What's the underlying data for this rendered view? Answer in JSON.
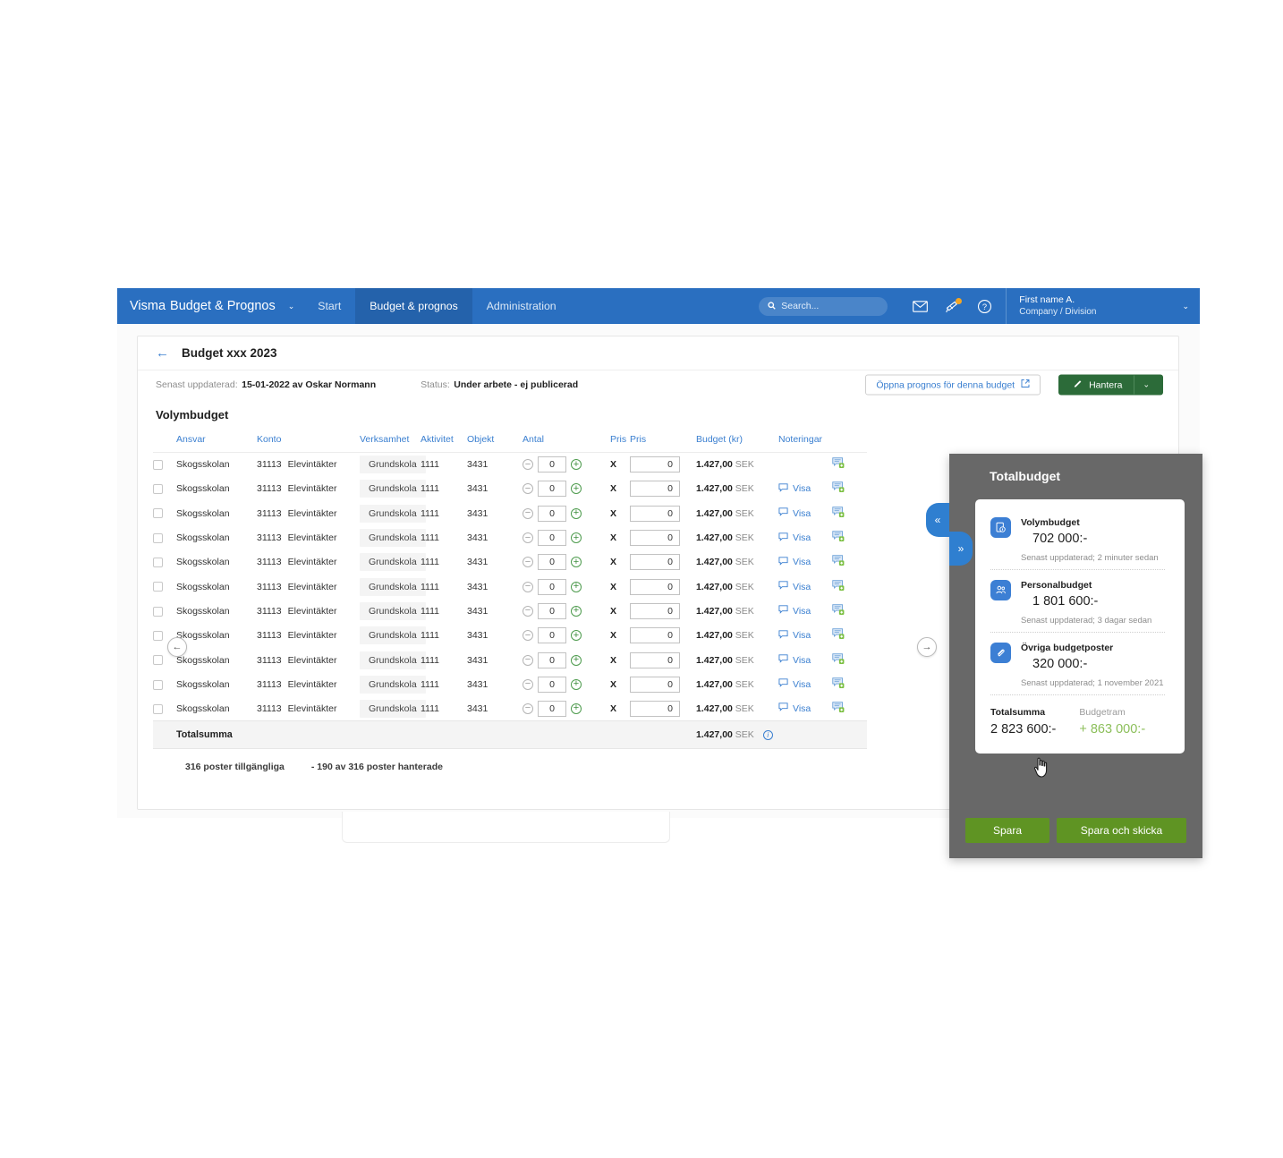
{
  "topbar": {
    "brand_primary": "Visma",
    "brand_secondary": "Budget & Prognos",
    "brand_caret": "⌄",
    "nav": [
      {
        "label": "Start",
        "active": false
      },
      {
        "label": "Budget & prognos",
        "active": true
      },
      {
        "label": "Administration",
        "active": false
      }
    ],
    "search_placeholder": "Search...",
    "icons": [
      "mail-icon",
      "megaphone-icon",
      "help-icon"
    ],
    "user_name": "First name A.",
    "user_org": "Company / Division",
    "user_caret": "⌄",
    "accent_color": "#2a6fc0",
    "active_tab_color": "#2462ab"
  },
  "card": {
    "back_arrow": "←",
    "title": "Budget xxx 2023",
    "meta": {
      "updated_label": "Senast uppdaterad:",
      "updated_value": "15-01-2022 av Oskar Normann",
      "status_label": "Status:",
      "status_value": "Under arbete - ej publicerad"
    },
    "actions": {
      "open_forecast": "Öppna  prognos för denna budget",
      "manage": "Hantera",
      "manage_caret": "⌄",
      "manage_color": "#2c6b39"
    },
    "section_title": "Volymbudget"
  },
  "table": {
    "headers": [
      "Ansvar",
      "Konto",
      "Verksamhet",
      "Aktivitet",
      "Objekt",
      "Antal",
      "Pris",
      "Pris",
      "Budget (kr)",
      "Noteringar"
    ],
    "rows": [
      {
        "ansvar": "Skogsskolan",
        "konto_num": "31113",
        "konto_name": "Elevintäkter",
        "verksamhet": "Grundskola",
        "aktivitet": "1111",
        "objekt": "3431",
        "antal": "0",
        "pris": "0",
        "x": "X",
        "budget_amount": "1.427,00",
        "budget_currency": "SEK",
        "note_link": "",
        "has_note_link": false
      },
      {
        "ansvar": "Skogsskolan",
        "konto_num": "31113",
        "konto_name": "Elevintäkter",
        "verksamhet": "Grundskola",
        "aktivitet": "1111",
        "objekt": "3431",
        "antal": "0",
        "pris": "0",
        "x": "X",
        "budget_amount": "1.427,00",
        "budget_currency": "SEK",
        "note_link": "Visa",
        "has_note_link": true
      },
      {
        "ansvar": "Skogsskolan",
        "konto_num": "31113",
        "konto_name": "Elevintäkter",
        "verksamhet": "Grundskola",
        "aktivitet": "1111",
        "objekt": "3431",
        "antal": "0",
        "pris": "0",
        "x": "X",
        "budget_amount": "1.427,00",
        "budget_currency": "SEK",
        "note_link": "Visa",
        "has_note_link": true
      },
      {
        "ansvar": "Skogsskolan",
        "konto_num": "31113",
        "konto_name": "Elevintäkter",
        "verksamhet": "Grundskola",
        "aktivitet": "1111",
        "objekt": "3431",
        "antal": "0",
        "pris": "0",
        "x": "X",
        "budget_amount": "1.427,00",
        "budget_currency": "SEK",
        "note_link": "Visa",
        "has_note_link": true
      },
      {
        "ansvar": "Skogsskolan",
        "konto_num": "31113",
        "konto_name": "Elevintäkter",
        "verksamhet": "Grundskola",
        "aktivitet": "1111",
        "objekt": "3431",
        "antal": "0",
        "pris": "0",
        "x": "X",
        "budget_amount": "1.427,00",
        "budget_currency": "SEK",
        "note_link": "Visa",
        "has_note_link": true
      },
      {
        "ansvar": "Skogsskolan",
        "konto_num": "31113",
        "konto_name": "Elevintäkter",
        "verksamhet": "Grundskola",
        "aktivitet": "1111",
        "objekt": "3431",
        "antal": "0",
        "pris": "0",
        "x": "X",
        "budget_amount": "1.427,00",
        "budget_currency": "SEK",
        "note_link": "Visa",
        "has_note_link": true
      },
      {
        "ansvar": "Skogsskolan",
        "konto_num": "31113",
        "konto_name": "Elevintäkter",
        "verksamhet": "Grundskola",
        "aktivitet": "1111",
        "objekt": "3431",
        "antal": "0",
        "pris": "0",
        "x": "X",
        "budget_amount": "1.427,00",
        "budget_currency": "SEK",
        "note_link": "Visa",
        "has_note_link": true
      },
      {
        "ansvar": "Skogsskolan",
        "konto_num": "31113",
        "konto_name": "Elevintäkter",
        "verksamhet": "Grundskola",
        "aktivitet": "1111",
        "objekt": "3431",
        "antal": "0",
        "pris": "0",
        "x": "X",
        "budget_amount": "1.427,00",
        "budget_currency": "SEK",
        "note_link": "Visa",
        "has_note_link": true
      },
      {
        "ansvar": "Skogsskolan",
        "konto_num": "31113",
        "konto_name": "Elevintäkter",
        "verksamhet": "Grundskola",
        "aktivitet": "1111",
        "objekt": "3431",
        "antal": "0",
        "pris": "0",
        "x": "X",
        "budget_amount": "1.427,00",
        "budget_currency": "SEK",
        "note_link": "Visa",
        "has_note_link": true
      },
      {
        "ansvar": "Skogsskolan",
        "konto_num": "31113",
        "konto_name": "Elevintäkter",
        "verksamhet": "Grundskola",
        "aktivitet": "1111",
        "objekt": "3431",
        "antal": "0",
        "pris": "0",
        "x": "X",
        "budget_amount": "1.427,00",
        "budget_currency": "SEK",
        "note_link": "Visa",
        "has_note_link": true
      },
      {
        "ansvar": "Skogsskolan",
        "konto_num": "31113",
        "konto_name": "Elevintäkter",
        "verksamhet": "Grundskola",
        "aktivitet": "1111",
        "objekt": "3431",
        "antal": "0",
        "pris": "0",
        "x": "X",
        "budget_amount": "1.427,00",
        "budget_currency": "SEK",
        "note_link": "Visa",
        "has_note_link": true
      }
    ],
    "total": {
      "label": "Totalsumma",
      "amount": "1.427,00",
      "currency": "SEK",
      "info": "i"
    },
    "footer": {
      "available": "316 poster tillgängliga",
      "handled": "- 190 av 316 poster hanterade"
    }
  },
  "pager": {
    "prev": "←",
    "next": "→"
  },
  "drawer": {
    "title": "Totalbudget",
    "collapse_handle": "«",
    "expand_handle": "»",
    "items": [
      {
        "icon": "budget-report-icon",
        "name": "Volymbudget",
        "amount": "702 000:-",
        "updated": "Senast uppdaterad; 2 minuter sedan"
      },
      {
        "icon": "people-icon",
        "name": "Personalbudget",
        "amount": "1 801 600:-",
        "updated": "Senast uppdaterad; 3 dagar sedan"
      },
      {
        "icon": "paperclip-icon",
        "name": "Övriga budgetposter",
        "amount": "320 000:-",
        "updated": "Senast uppdaterad; 1 november 2021"
      }
    ],
    "summary": {
      "total_label": "Totalsumma",
      "total_value": "2 823 600:-",
      "frame_label": "Budgetram",
      "frame_value": "+ 863 000:-",
      "frame_color": "#8cbf5a"
    },
    "buttons": {
      "save": "Spara",
      "save_send": "Spara och skicka",
      "color": "#5f9423"
    },
    "background": "#686868"
  }
}
